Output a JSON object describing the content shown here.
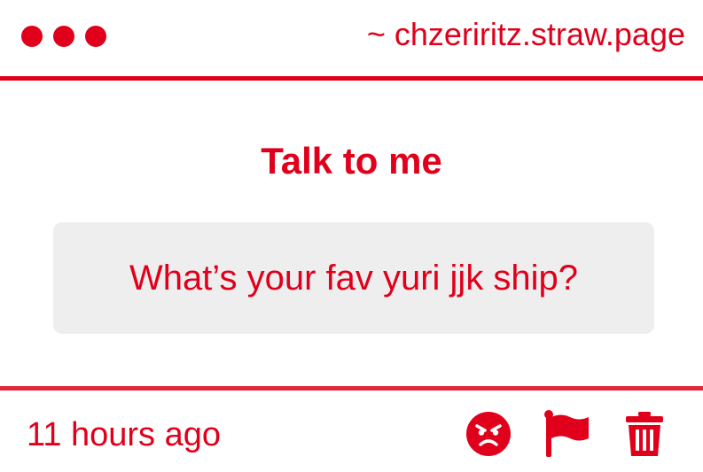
{
  "header": {
    "url": "~ chzeriritz.straw.page",
    "window_dots": [
      "dot",
      "dot",
      "dot"
    ]
  },
  "main": {
    "title": "Talk to me",
    "message": "What’s your fav yuri jjk ship?"
  },
  "footer": {
    "timestamp": "11 hours ago",
    "actions": [
      {
        "name": "angry-face-icon"
      },
      {
        "name": "flag-icon"
      },
      {
        "name": "trash-icon"
      }
    ]
  },
  "colors": {
    "accent": "#e0001b",
    "message_bg": "#efeeee",
    "background": "#ffffff"
  }
}
